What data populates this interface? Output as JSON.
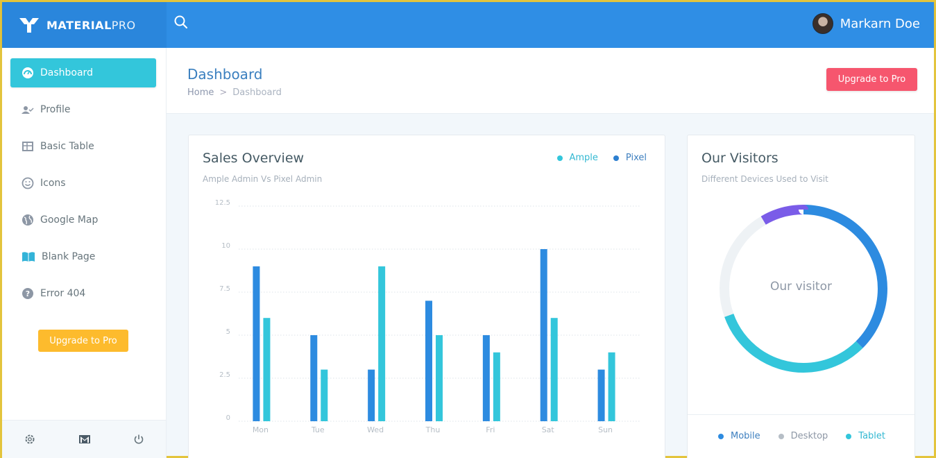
{
  "header": {
    "logo_strong": "MATERIAL",
    "logo_light": "PRO",
    "user_name": "Markarn Doe",
    "search_icon": "search-icon"
  },
  "sidebar": {
    "items": [
      {
        "label": "Dashboard",
        "icon": "dashboard-gauge-icon",
        "active": true
      },
      {
        "label": "Profile",
        "icon": "user-check-icon"
      },
      {
        "label": "Basic Table",
        "icon": "table-icon"
      },
      {
        "label": "Icons",
        "icon": "smiley-icon"
      },
      {
        "label": "Google Map",
        "icon": "globe-icon"
      },
      {
        "label": "Blank Page",
        "icon": "book-open-icon"
      },
      {
        "label": "Error 404",
        "icon": "help-circle-icon"
      }
    ],
    "upgrade_label": "Upgrade to Pro",
    "bottom_icons": [
      "gear-icon",
      "mail-icon",
      "power-icon"
    ]
  },
  "page": {
    "title": "Dashboard",
    "breadcrumb": [
      "Home",
      "Dashboard"
    ],
    "upgrade_label": "Upgrade to Pro"
  },
  "sales": {
    "title": "Sales Overview",
    "subtitle": "Ample Admin Vs Pixel Admin",
    "legend": [
      "Ample",
      "Pixel"
    ]
  },
  "visitors": {
    "title": "Our Visitors",
    "subtitle": "Different Devices Used to Visit",
    "center_label": "Our visitor",
    "legend": [
      "Mobile",
      "Desktop",
      "Tablet"
    ]
  },
  "colors": {
    "primary": "#2f8ee5",
    "ample": "#33c6db",
    "pixel": "#2d8be0",
    "desktop": "#eef2f5",
    "other": "#7a5ce8",
    "danger": "#f6566e",
    "warning": "#fdbb2d"
  },
  "chart_data": [
    {
      "type": "bar",
      "categories": [
        "Mon",
        "Tue",
        "Wed",
        "Thu",
        "Fri",
        "Sat",
        "Sun"
      ],
      "series": [
        {
          "name": "Pixel",
          "color": "#2d8be0",
          "values": [
            9,
            5,
            3,
            7,
            5,
            10,
            3
          ]
        },
        {
          "name": "Ample",
          "color": "#33c6db",
          "values": [
            6,
            3,
            9,
            5,
            4,
            6,
            4
          ]
        }
      ],
      "yticks": [
        "0",
        "2.5",
        "5",
        "7.5",
        "10",
        "12.5"
      ],
      "ylim": [
        0,
        12.5
      ],
      "grid": true,
      "legend_position": "top-right"
    },
    {
      "type": "pie",
      "donut": true,
      "slices": [
        {
          "name": "Mobile",
          "value": 37.5,
          "color": "#2d8be0"
        },
        {
          "name": "Tablet",
          "value": 32,
          "color": "#33c6db"
        },
        {
          "name": "Desktop",
          "value": 22,
          "color": "#eef2f5"
        },
        {
          "name": "",
          "value": 8.5,
          "color": "#7a5ce8"
        }
      ]
    }
  ]
}
